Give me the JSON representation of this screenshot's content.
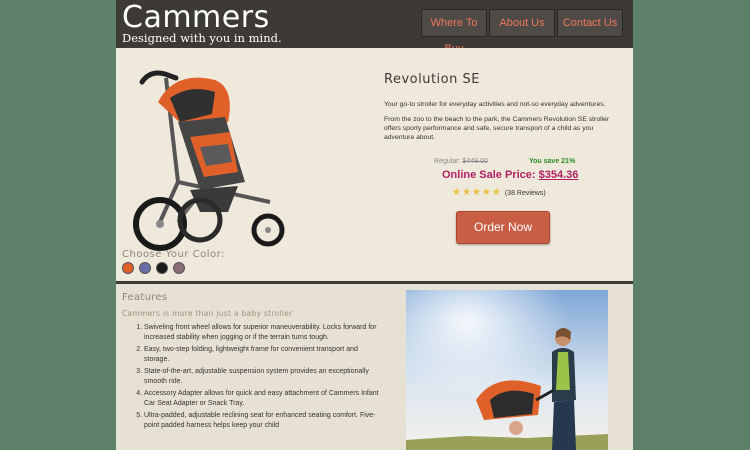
{
  "header": {
    "logo": "Cammers",
    "tagline": "Designed with you in mind.",
    "nav": [
      "Where To Buy",
      "About Us",
      "Contact Us"
    ]
  },
  "product": {
    "title": "Revolution SE",
    "description": [
      "Your go-to stroller for everyday activities and not-so everyday adventures.",
      "From the zoo to the beach to the park, the Cammers Revolution SE stroller offers sporty performance and safe, secure transport of a child as you adventure about."
    ],
    "regular_label": "Regular:",
    "regular_price": "$449.00",
    "savings": "You save 21%",
    "sale_label": "Online Sale Price:",
    "sale_price": "$354.36",
    "rating": 5,
    "reviews": "(38 Reviews)",
    "order_button": "Order Now",
    "choose_color_label": "Choose Your Color:",
    "colors": [
      "#e0602a",
      "#6a6fa8",
      "#1a1a1a",
      "#8a6b78"
    ],
    "icons": [
      "stroller-image",
      "star-icon"
    ]
  },
  "features": {
    "title": "Features",
    "subtitle": "Cammers is more than just a baby stroller",
    "items": [
      "Swiveling front wheel allows for superior maneuverability. Locks forward for increased stability when jogging or if the terrain turns tough.",
      "Easy, two-step folding, lightweight frame for convenient transport and storage.",
      "State-of-the-art, adjustable suspension system provides an exceptionally smooth ride.",
      "Accessory Adapter allows for quick and easy attachment of Cammers Infant Car Seat Adapter or Snack Tray.",
      "Ultra-padded, adjustable reclining seat for enhanced seating comfort. Five-point padded harness helps keep your child"
    ]
  },
  "colors": {
    "background": "#5d8068",
    "header": "#3d3a35",
    "nav_text": "#f0775f",
    "sale": "#b02060",
    "save": "#2a8a2a",
    "order_button": "#c95e45"
  }
}
